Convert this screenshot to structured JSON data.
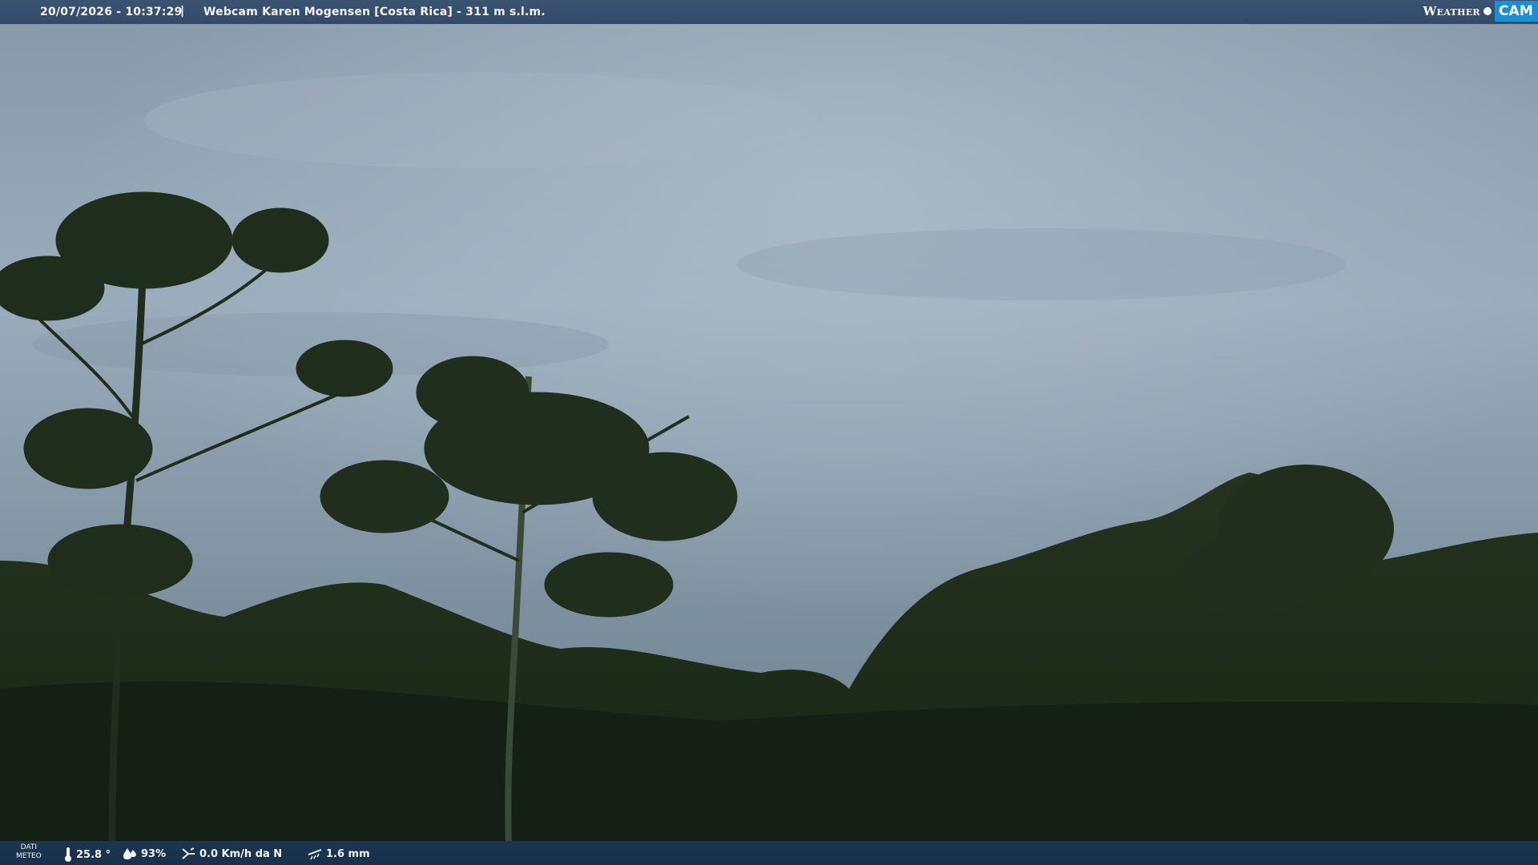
{
  "header": {
    "timestamp": "20/07/2026 - 10:37:29",
    "separator": "|",
    "title": "Webcam Karen Mogensen [Costa Rica]  - 311 m s.l.m."
  },
  "logo": {
    "text_weather": "Weather",
    "text_cam": "CAM"
  },
  "weather": {
    "label_line1": "DATI",
    "label_line2": "METEO",
    "temperature": "25.8 °",
    "humidity": "93%",
    "wind": "0.0 Km/h da N",
    "rain": "1.6 mm"
  },
  "icons": {
    "temperature": "thermometer-icon",
    "humidity": "humidity-drop-icon",
    "wind": "wind-icon",
    "rain": "rain-icon"
  },
  "colors": {
    "header_bar": "#3b5472",
    "footer_bar": "#1d3550",
    "logo_accent": "#1a8fd6"
  }
}
